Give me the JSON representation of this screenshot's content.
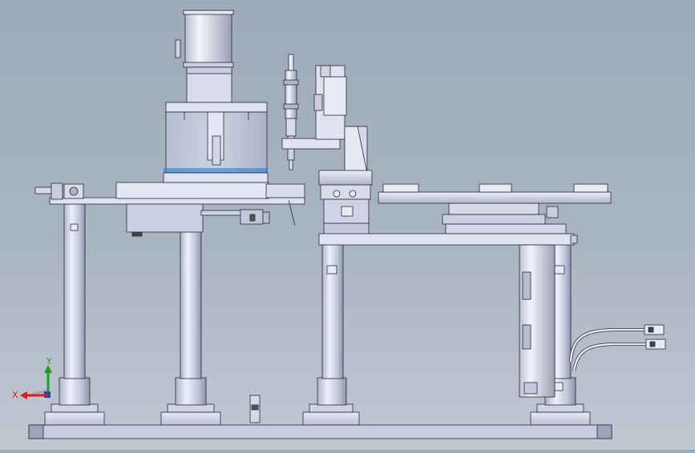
{
  "triad": {
    "y_label": "Y",
    "x_label": "X"
  },
  "colors": {
    "background_top": "#9eaab9",
    "background_bottom": "#c0c8d2",
    "part_light": "#dfe2f0",
    "part_mid": "#c3c8dd",
    "part_dark": "#9aa0b8",
    "edge": "#2a2a35",
    "axis_y": "#1aa31a",
    "axis_x": "#d42020",
    "axis_z": "#2040d0",
    "dots_blue": "#2a7fd6"
  }
}
